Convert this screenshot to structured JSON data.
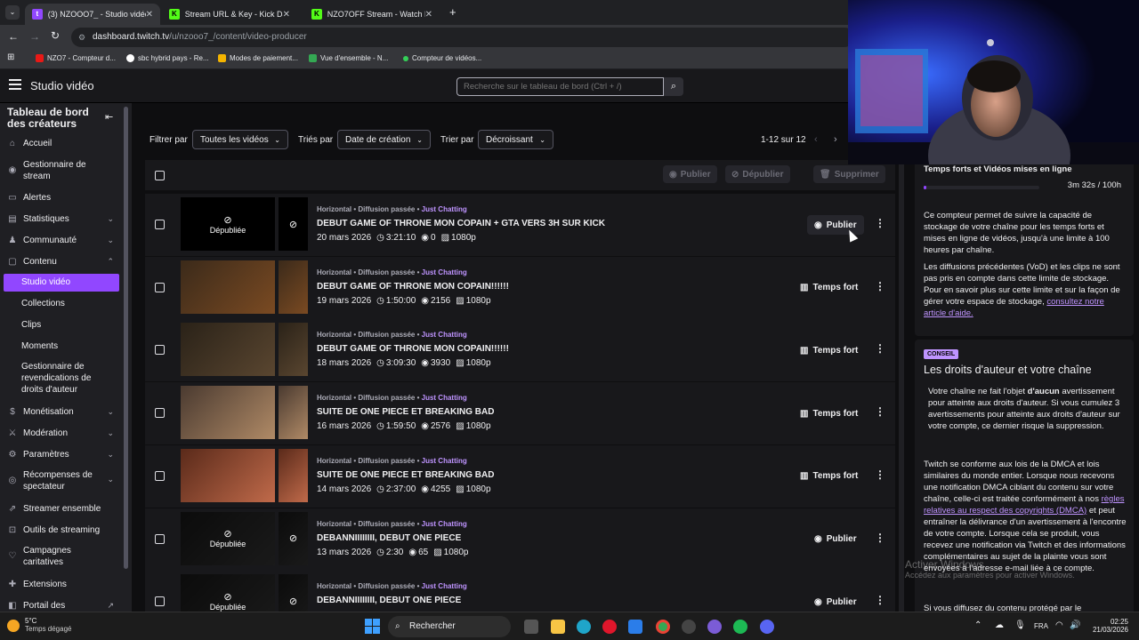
{
  "browser": {
    "tabs": [
      {
        "label": "(3) NZOOO7_ - Studio vidéo - T",
        "icon": "twitch-icon"
      },
      {
        "label": "Stream URL & Key - Kick Dashb",
        "icon": "kick-icon"
      },
      {
        "label": "NZO7OFF Stream - Watch Live",
        "icon": "kick-icon"
      }
    ],
    "url_domain": "dashboard.twitch.tv",
    "url_path": "/u/nzooo7_/content/video-producer",
    "bookmarks": [
      "NZO7 - Compteur d...",
      "sbc hybrid pays - Re...",
      "Modes de paiement...",
      "Vue d'ensemble - N...",
      "Compteur de vidéos..."
    ]
  },
  "header": {
    "title": "Studio vidéo",
    "search_placeholder": "Recherche sur le tableau de bord (Ctrl + /)"
  },
  "sidebar": {
    "title": "Tableau de bord des créateurs",
    "items": [
      {
        "label": "Accueil",
        "icon": "home-icon"
      },
      {
        "label": "Gestionnaire de stream",
        "icon": "stream-icon"
      },
      {
        "label": "Alertes",
        "icon": "alert-icon"
      },
      {
        "label": "Statistiques",
        "icon": "stats-icon"
      },
      {
        "label": "Communauté",
        "icon": "community-icon"
      },
      {
        "label": "Contenu",
        "icon": "content-icon"
      }
    ],
    "subitems": [
      "Studio vidéo",
      "Collections",
      "Clips",
      "Moments",
      "Gestionnaire de revendications de droits d'auteur"
    ],
    "items2": [
      {
        "label": "Monétisation",
        "icon": "money-icon"
      },
      {
        "label": "Modération",
        "icon": "mod-icon"
      },
      {
        "label": "Paramètres",
        "icon": "gear-icon"
      },
      {
        "label": "Récompenses de spectateur",
        "icon": "reward-icon"
      },
      {
        "label": "Streamer ensemble",
        "icon": "together-icon"
      },
      {
        "label": "Outils de streaming",
        "icon": "tools-icon"
      },
      {
        "label": "Campagnes caritatives",
        "icon": "charity-icon"
      },
      {
        "label": "Extensions",
        "icon": "extension-icon"
      },
      {
        "label": "Portail des",
        "icon": "portal-icon"
      }
    ]
  },
  "filters": {
    "filter_label": "Filtrer par",
    "filter_value": "Toutes les vidéos",
    "sort_label": "Triés par",
    "sort_value": "Date de création",
    "order_label": "Trier par",
    "order_value": "Décroissant",
    "pagination": "1-12 sur 12"
  },
  "bulk": {
    "publish": "Publier",
    "unpublish": "Dépublier",
    "delete": "Supprimer"
  },
  "videos": [
    {
      "meta": "Horizontal • Diffusion passée • ",
      "game": "Just Chatting",
      "title": "DEBUT GAME OF THRONE MON COPAIN + GTA VERS 3H SUR KICK",
      "date": "20 mars 2026",
      "duration": "3:21:10",
      "views": "0",
      "quality": "1080p",
      "action": "Publier",
      "unpublished": true
    },
    {
      "meta": "Horizontal • Diffusion passée • ",
      "game": "Just Chatting",
      "title": "DEBUT GAME OF THRONE MON COPAIN!!!!!!",
      "date": "19 mars 2026",
      "duration": "1:50:00",
      "views": "2156",
      "quality": "1080p",
      "action": "Temps fort",
      "unpublished": false
    },
    {
      "meta": "Horizontal • Diffusion passée • ",
      "game": "Just Chatting",
      "title": "DEBUT GAME OF THRONE MON COPAIN!!!!!!",
      "date": "18 mars 2026",
      "duration": "3:09:30",
      "views": "3930",
      "quality": "1080p",
      "action": "Temps fort",
      "unpublished": false
    },
    {
      "meta": "Horizontal • Diffusion passée • ",
      "game": "Just Chatting",
      "title": "SUITE DE ONE PIECE ET BREAKING BAD",
      "date": "16 mars 2026",
      "duration": "1:59:50",
      "views": "2576",
      "quality": "1080p",
      "action": "Temps fort",
      "unpublished": false
    },
    {
      "meta": "Horizontal • Diffusion passée • ",
      "game": "Just Chatting",
      "title": "SUITE DE ONE PIECE ET BREAKING BAD",
      "date": "14 mars 2026",
      "duration": "2:37:00",
      "views": "4255",
      "quality": "1080p",
      "action": "Temps fort",
      "unpublished": false
    },
    {
      "meta": "Horizontal • Diffusion passée • ",
      "game": "Just Chatting",
      "title": "DEBANNIIIIIIII, DEBUT ONE PIECE",
      "date": "13 mars 2026",
      "duration": "2:30",
      "views": "65",
      "quality": "1080p",
      "action": "Publier",
      "unpublished": true
    },
    {
      "meta": "Horizontal • Diffusion passée • ",
      "game": "Just Chatting",
      "title": "DEBANNIIIIIIII, DEBUT ONE PIECE",
      "date": "",
      "duration": "",
      "views": "",
      "quality": "",
      "action": "Publier",
      "unpublished": true
    }
  ],
  "unpublished_label": "Dépubliée",
  "storage": {
    "title": "Temps forts et Vidéos mises en ligne",
    "value": "3m 32s / 100h",
    "progress": 0.0006,
    "p1": "Ce compteur permet de suivre la capacité de stockage de votre chaîne pour les temps forts et mises en ligne de vidéos, jusqu'à une limite à 100 heures par chaîne.",
    "p2": "Les diffusions précédentes (VoD) et les clips ne sont pas pris en compte dans cette limite de stockage. Pour en savoir plus sur cette limite et sur la façon de gérer votre espace de stockage,",
    "p2_link": "consultez notre article d'aide."
  },
  "copyright": {
    "badge": "CONSEIL",
    "title": "Les droits d'auteur et votre chaîne",
    "p1a": "Votre chaîne ne fait l'objet ",
    "p1b": "d'aucun",
    "p1c": " avertissement pour atteinte aux droits d'auteur. Si vous cumulez 3 avertissements pour atteinte aux droits d'auteur sur votre compte, ce dernier risque la suppression.",
    "p2a": "Twitch se conforme aux lois de la DMCA et lois similaires du monde entier. Lorsque nous recevons une notification DMCA ciblant du contenu sur votre chaîne, celle-ci est traitée conformément à nos ",
    "p2link": "règles relatives au respect des copyrights (DMCA)",
    "p2b": " et peut entraîner la délivrance d'un avertissement à l'encontre de votre compte. Lorsque cela se produit, vous recevez une notification via Twitch et des informations complémentaires au sujet de la plainte vous sont envoyées à l'adresse e-mail liée à ce compte.",
    "p3": "Si vous diffusez du contenu protégé par le"
  },
  "watermark": {
    "line1": "Activer Windows",
    "line2": "Accédez aux paramètres pour activer Windows."
  },
  "taskbar": {
    "weather_temp": "5°C",
    "weather_desc": "Temps dégagé",
    "search": "Rechercher",
    "lang": "FRA",
    "time": "02:25",
    "date": "21/03/2026"
  },
  "colors": {
    "accent": "#9147ff",
    "link": "#bf94ff"
  }
}
